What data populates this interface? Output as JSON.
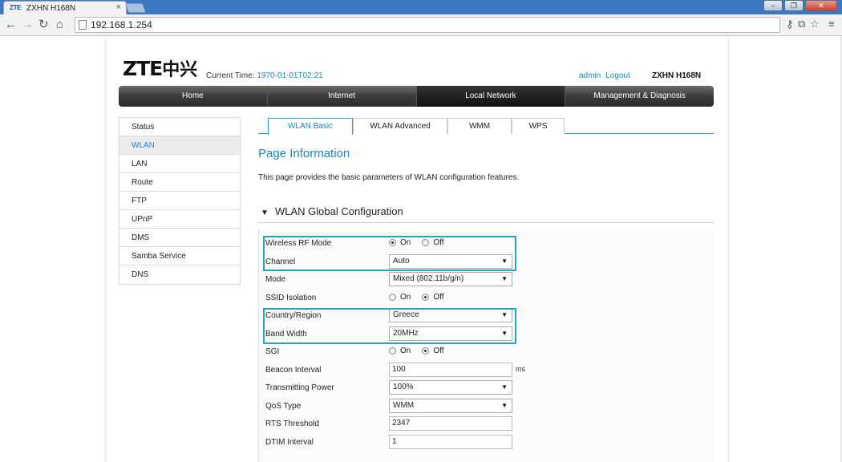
{
  "browser": {
    "tab_favicon": "ZTE",
    "tab_title": "ZXHN H168N",
    "tab_close": "×",
    "url": "192.168.1.254",
    "window_controls": {
      "minimize": "–",
      "restore": "❐",
      "close": "✕"
    }
  },
  "header": {
    "logo_latin": "ZTE",
    "logo_cn": "中兴",
    "current_time_label": "Current Time:",
    "current_time_value": "1970-01-01T02:21",
    "user": "admin",
    "logout": "Logout",
    "device": "ZXHN H168N"
  },
  "mainnav": {
    "items": [
      {
        "label": "Home",
        "active": false
      },
      {
        "label": "Internet",
        "active": false
      },
      {
        "label": "Local Network",
        "active": true
      },
      {
        "label": "Management & Diagnosis",
        "active": false
      }
    ]
  },
  "sidebar": {
    "items": [
      {
        "label": "Status"
      },
      {
        "label": "WLAN"
      },
      {
        "label": "LAN"
      },
      {
        "label": "Route"
      },
      {
        "label": "FTP"
      },
      {
        "label": "UPnP"
      },
      {
        "label": "DMS"
      },
      {
        "label": "Samba Service"
      },
      {
        "label": "DNS"
      }
    ],
    "active_index": 1
  },
  "subtabs": {
    "items": [
      {
        "label": "WLAN Basic"
      },
      {
        "label": "WLAN Advanced"
      },
      {
        "label": "WMM"
      },
      {
        "label": "WPS"
      }
    ],
    "active_index": 0
  },
  "page_info": {
    "title": "Page Information",
    "description": "This page provides the basic parameters of WLAN configuration features."
  },
  "section": {
    "title": "WLAN Global Configuration"
  },
  "form": {
    "wireless_rf_mode": {
      "label": "Wireless RF Mode",
      "on": "On",
      "off": "Off",
      "selected": "On"
    },
    "channel": {
      "label": "Channel",
      "value": "Auto"
    },
    "mode": {
      "label": "Mode",
      "value": "Mixed (802.11b/g/n)"
    },
    "ssid_isolation": {
      "label": "SSID Isolation",
      "on": "On",
      "off": "Off",
      "selected": "Off"
    },
    "country_region": {
      "label": "Country/Region",
      "value": "Greece"
    },
    "band_width": {
      "label": "Band Width",
      "value": "20MHz"
    },
    "sgi": {
      "label": "SGI",
      "on": "On",
      "off": "Off",
      "selected": "Off"
    },
    "beacon_interval": {
      "label": "Beacon Interval",
      "value": "100",
      "unit": "ms"
    },
    "transmitting_power": {
      "label": "Transmitting Power",
      "value": "100%"
    },
    "qos_type": {
      "label": "QoS Type",
      "value": "WMM"
    },
    "rts_threshold": {
      "label": "RTS Threshold",
      "value": "2347"
    },
    "dtim_interval": {
      "label": "DTIM Interval",
      "value": "1"
    }
  },
  "colors": {
    "accent": "#1a87c9",
    "highlight_border": "#21a5c9",
    "nav_dark": "#2b2b2b"
  }
}
